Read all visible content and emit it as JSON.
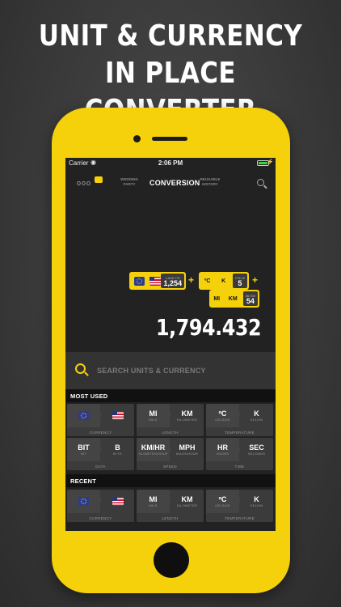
{
  "headline": {
    "line1": "UNIT & CURRENCY",
    "line2": "IN PLACE CONVERTER"
  },
  "status_bar": {
    "carrier": "Carrier",
    "time": "2:06 PM"
  },
  "nav": {
    "menu_dots": "ooo",
    "tab_left": "WEDDING PARTY",
    "tab_center": "CONVERSION",
    "tab_right": "REUSABLE HISTORY"
  },
  "conversions": [
    {
      "from": "",
      "to": "",
      "caption": "1,608.775",
      "value": "1,254"
    },
    {
      "from": "ºC",
      "to": "K",
      "caption": "278.15",
      "value": "5"
    },
    {
      "from": "MI",
      "to": "KM",
      "caption": "86.905",
      "value": "54"
    }
  ],
  "result": "1,794.432",
  "search": {
    "placeholder": "SEARCH UNITS & CURRENCY"
  },
  "most_used": {
    "title": "MOST USED",
    "cards": [
      {
        "from": "",
        "from_sub": "",
        "to": "",
        "to_sub": "",
        "category": "CURRENCY",
        "flags": true
      },
      {
        "from": "MI",
        "from_sub": "MILE",
        "to": "KM",
        "to_sub": "KILOMETER",
        "category": "LENGTH"
      },
      {
        "from": "ºC",
        "from_sub": "CELSIUS",
        "to": "K",
        "to_sub": "KELVIN",
        "category": "TEMPERATURE"
      },
      {
        "from": "BIT",
        "from_sub": "BIT",
        "to": "B",
        "to_sub": "BYTE",
        "category": "DATA"
      },
      {
        "from": "KM/HR",
        "from_sub": "KILOMETERS/HOUR",
        "to": "MPH",
        "to_sub": "MILES/HOUR",
        "category": "SPEED"
      },
      {
        "from": "HR",
        "from_sub": "HOURS",
        "to": "SEC",
        "to_sub": "SECONDS",
        "category": "TIME"
      }
    ]
  },
  "recent": {
    "title": "RECENT",
    "cards": [
      {
        "from": "",
        "from_sub": "",
        "to": "",
        "to_sub": "",
        "category": "CURRENCY",
        "flags": true
      },
      {
        "from": "MI",
        "from_sub": "MILE",
        "to": "KM",
        "to_sub": "KILOMETER",
        "category": "LENGTH"
      },
      {
        "from": "ºC",
        "from_sub": "CELSIUS",
        "to": "K",
        "to_sub": "KELVIN",
        "category": "TEMPERATURE"
      }
    ]
  },
  "colors": {
    "accent": "#f5d10b",
    "background": "#222222",
    "card": "#3b3b3b"
  }
}
